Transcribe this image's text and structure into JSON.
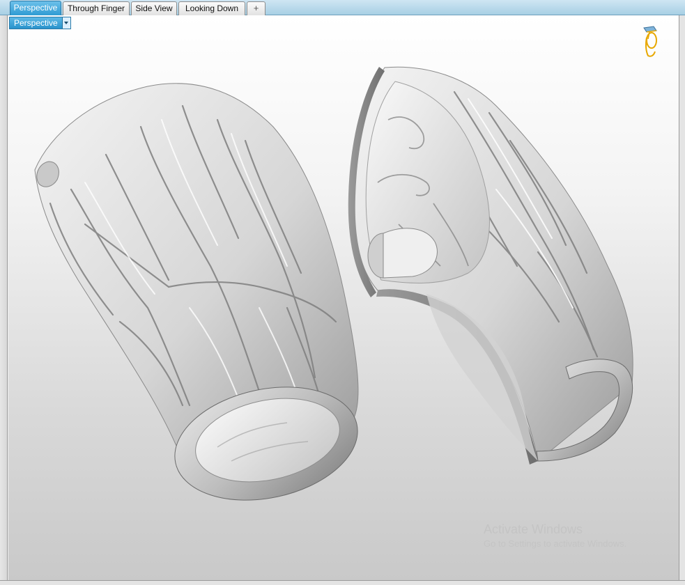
{
  "tabs": [
    {
      "label": "Perspective",
      "active": true
    },
    {
      "label": "Through Finger",
      "active": false
    },
    {
      "label": "Side View",
      "active": false
    },
    {
      "label": "Looking Down",
      "active": false
    }
  ],
  "add_tab_glyph": "+",
  "viewport": {
    "label": "Perspective",
    "background": "#d9d9d9",
    "camera_icon": "camera-icon",
    "dropdown_icon": "chevron-down-icon"
  },
  "model": {
    "left_piece": "textured-ring-whole",
    "right_piece": "textured-ring-cutaway",
    "surface_color": "#e0e0e0"
  },
  "watermark": {
    "title": "Activate Windows",
    "subtitle": "Go to Settings to activate Windows."
  },
  "colors": {
    "tab_active": "#3aa7dc",
    "tabbar_bg": "#b8dcef"
  }
}
